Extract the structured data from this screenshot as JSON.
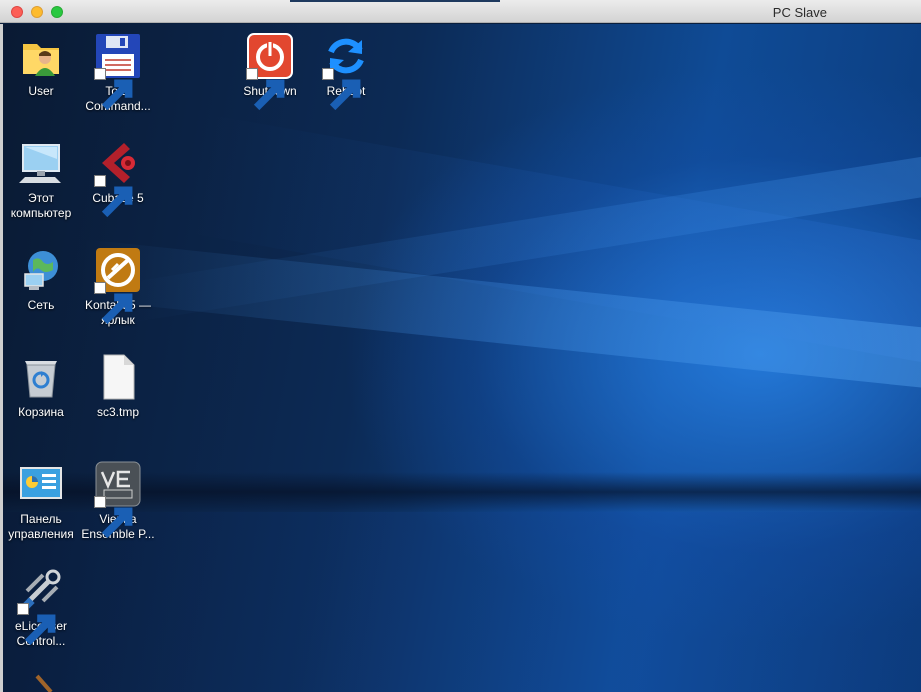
{
  "window": {
    "title": "PC Slave"
  },
  "desktop": {
    "icons": [
      {
        "name": "User",
        "line2": "",
        "icon": "user-folder-icon"
      },
      {
        "name": "Total",
        "line2": "Command...",
        "icon": "floppy-disk-icon"
      },
      {
        "name": "Shutdown",
        "line2": "",
        "icon": "power-icon"
      },
      {
        "name": "Reboot",
        "line2": "",
        "icon": "refresh-icon"
      },
      {
        "name": "Этот",
        "line2": "компьютер",
        "icon": "computer-icon"
      },
      {
        "name": "Cubase 5",
        "line2": "",
        "icon": "cubase-icon"
      },
      {
        "name": "Сеть",
        "line2": "",
        "icon": "network-globe-icon"
      },
      {
        "name": "Kontakt 5 —",
        "line2": "ярлык",
        "icon": "kontakt-icon"
      },
      {
        "name": "Корзина",
        "line2": "",
        "icon": "recycle-bin-icon"
      },
      {
        "name": "sc3.tmp",
        "line2": "",
        "icon": "blank-file-icon"
      },
      {
        "name": "Панель",
        "line2": "управления",
        "icon": "control-panel-icon"
      },
      {
        "name": "Vienna",
        "line2": "Ensemble P...",
        "icon": "vienna-ensemble-icon"
      },
      {
        "name": "eLicenser",
        "line2": "Control...",
        "icon": "usb-keys-icon"
      }
    ]
  }
}
